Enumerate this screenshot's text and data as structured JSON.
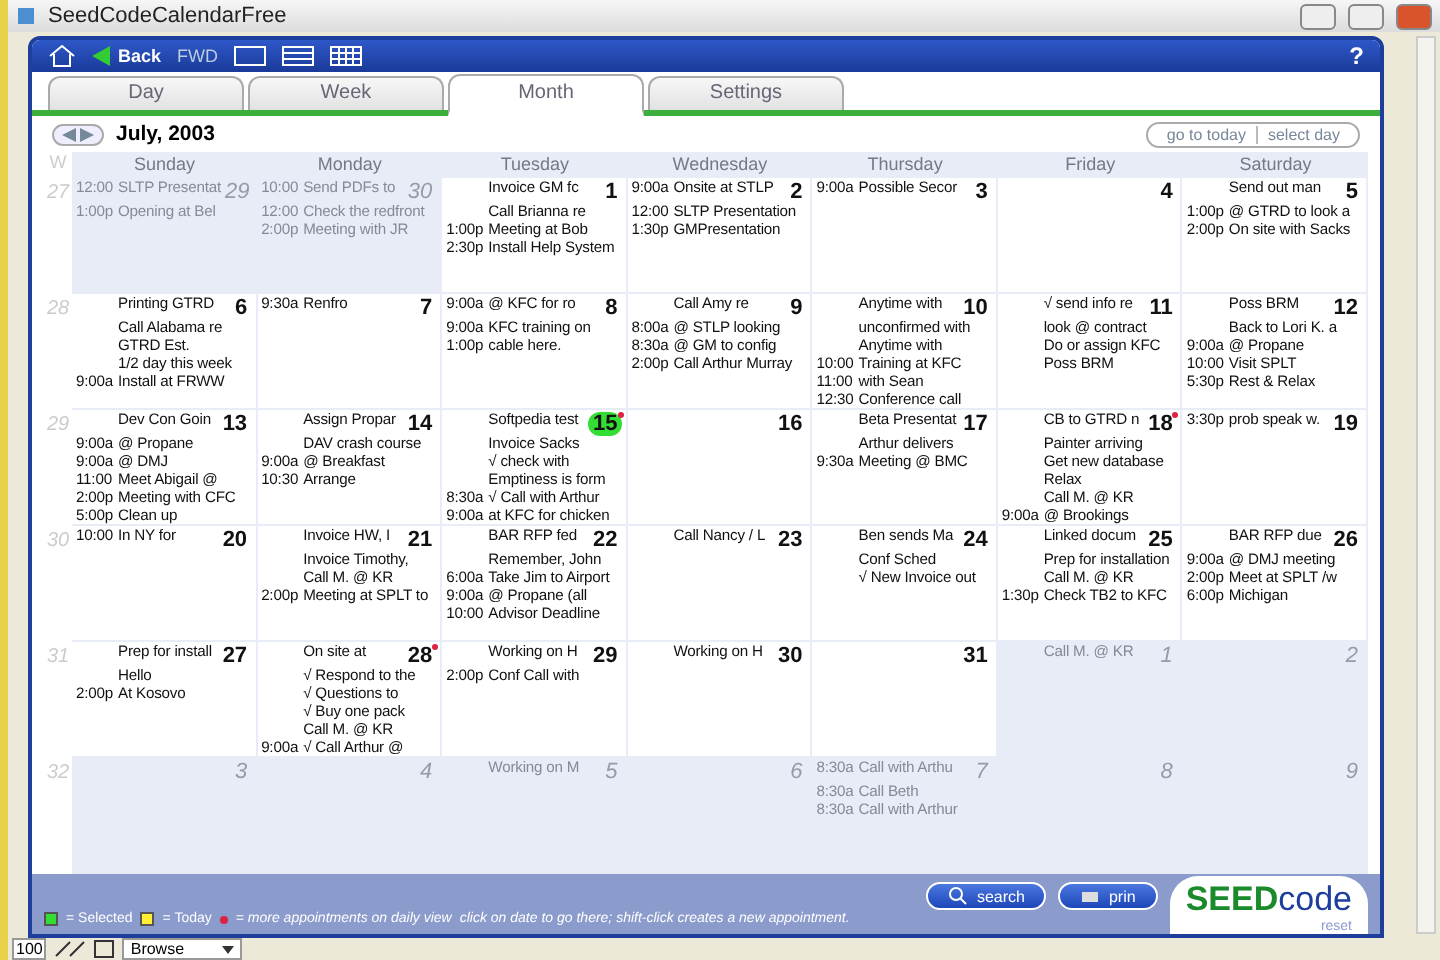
{
  "window": {
    "title": "SeedCodeCalendarFree"
  },
  "toolbar": {
    "back": "Back",
    "forward": "FWD",
    "help": "?"
  },
  "tabs": [
    {
      "label": "Day",
      "selected": false
    },
    {
      "label": "Week",
      "selected": false
    },
    {
      "label": "Month",
      "selected": true
    },
    {
      "label": "Settings",
      "selected": false
    }
  ],
  "month_nav": {
    "title": "July, 2003",
    "buttons": [
      "go to today",
      "select day"
    ]
  },
  "calendar": {
    "week_header": "W",
    "weekdays": [
      "Sunday",
      "Monday",
      "Tuesday",
      "Wednesday",
      "Thursday",
      "Friday",
      "Saturday"
    ],
    "weeks": [
      {
        "number": "27",
        "days": [
          {
            "date": "29",
            "in_month": false,
            "selected": false,
            "more": false,
            "items": [
              {
                "time": "12:00",
                "text": "SLTP Presentat"
              },
              {
                "time": "1:00p",
                "text": "Opening at Bel"
              }
            ]
          },
          {
            "date": "30",
            "in_month": false,
            "selected": false,
            "more": false,
            "items": [
              {
                "time": "10:00",
                "text": "Send PDFs to"
              },
              {
                "time": "12:00",
                "text": "Check the redfront"
              },
              {
                "time": "2:00p",
                "text": "Meeting with JR"
              }
            ]
          },
          {
            "date": "1",
            "in_month": true,
            "selected": false,
            "more": false,
            "items": [
              {
                "text": "Invoice GM fc"
              },
              {
                "text": "Call Brianna re"
              },
              {
                "time": "1:00p",
                "text": "Meeting at Bob"
              },
              {
                "time": "2:30p",
                "text": "Install Help System"
              }
            ]
          },
          {
            "date": "2",
            "in_month": true,
            "selected": false,
            "more": false,
            "items": [
              {
                "time": "9:00a",
                "text": "Onsite at STLP"
              },
              {
                "time": "12:00",
                "text": "SLTP Presentation"
              },
              {
                "time": "1:30p",
                "text": "GMPresentation"
              }
            ]
          },
          {
            "date": "3",
            "in_month": true,
            "selected": false,
            "more": false,
            "items": [
              {
                "time": "9:00a",
                "text": "Possible Secor"
              }
            ]
          },
          {
            "date": "4",
            "in_month": true,
            "selected": false,
            "more": false
          },
          {
            "date": "5",
            "in_month": true,
            "selected": false,
            "more": false,
            "items": [
              {
                "text": "Send out man"
              },
              {
                "time": "1:00p",
                "text": "@ GTRD to look a"
              },
              {
                "time": "2:00p",
                "text": "On site with Sacks"
              }
            ]
          }
        ]
      },
      {
        "number": "28",
        "days": [
          {
            "date": "6",
            "in_month": true,
            "selected": false,
            "more": false,
            "items": [
              {
                "text": "Printing GTRD"
              },
              {
                "text": "Call Alabama re"
              },
              {
                "text": "GTRD Est."
              },
              {
                "text": "1/2 day this week"
              },
              {
                "time": "9:00a",
                "text": "Install at FRWW"
              }
            ]
          },
          {
            "date": "7",
            "in_month": true,
            "selected": false,
            "more": false,
            "items": [
              {
                "time": "9:30a",
                "text": "Renfro"
              }
            ]
          },
          {
            "date": "8",
            "in_month": true,
            "selected": false,
            "more": false,
            "items": [
              {
                "time": "9:00a",
                "text": "@ KFC for ro"
              },
              {
                "time": "9:00a",
                "text": "KFC training on"
              },
              {
                "time": "1:00p",
                "text": "cable here."
              }
            ]
          },
          {
            "date": "9",
            "in_month": true,
            "selected": false,
            "more": false,
            "items": [
              {
                "text": "Call Amy re"
              },
              {
                "time": "8:00a",
                "text": "@ STLP looking"
              },
              {
                "time": "8:30a",
                "text": "@ GM to config"
              },
              {
                "time": "2:00p",
                "text": "Call Arthur Murray"
              }
            ]
          },
          {
            "date": "10",
            "in_month": true,
            "selected": false,
            "more": false,
            "items": [
              {
                "text": "Anytime with"
              },
              {
                "text": "unconfirmed with"
              },
              {
                "text": "Anytime with"
              },
              {
                "time": "10:00",
                "text": "Training at KFC"
              },
              {
                "time": "11:00",
                "text": "with Sean"
              },
              {
                "time": "12:30",
                "text": "Conference call"
              }
            ]
          },
          {
            "date": "11",
            "in_month": true,
            "selected": false,
            "more": false,
            "items": [
              {
                "text": "√ send info re"
              },
              {
                "text": "look @ contract"
              },
              {
                "text": "Do or assign KFC"
              },
              {
                "text": "Poss BRM"
              }
            ]
          },
          {
            "date": "12",
            "in_month": true,
            "selected": false,
            "more": false,
            "items": [
              {
                "text": "Poss BRM"
              },
              {
                "text": "Back to Lori K. a"
              },
              {
                "time": "9:00a",
                "text": "@ Propane"
              },
              {
                "time": "10:00",
                "text": "Visit SPLT"
              },
              {
                "time": "5:30p",
                "text": "Rest & Relax"
              }
            ]
          }
        ]
      },
      {
        "number": "29",
        "days": [
          {
            "date": "13",
            "in_month": true,
            "selected": false,
            "more": false,
            "items": [
              {
                "text": "Dev Con Goin"
              },
              {
                "time": "9:00a",
                "text": "@ Propane"
              },
              {
                "time": "9:00a",
                "text": "@ DMJ"
              },
              {
                "time": "11:00",
                "text": "Meet Abigail @"
              },
              {
                "time": "2:00p",
                "text": "Meeting with CFC"
              },
              {
                "time": "5:00p",
                "text": "Clean up"
              }
            ]
          },
          {
            "date": "14",
            "in_month": true,
            "selected": false,
            "more": false,
            "items": [
              {
                "text": "Assign Propar"
              },
              {
                "text": "DAV crash course"
              },
              {
                "time": "9:00a",
                "text": "@ Breakfast"
              },
              {
                "time": "10:30",
                "text": "Arrange"
              }
            ]
          },
          {
            "date": "15",
            "in_month": true,
            "selected": true,
            "more": true,
            "items": [
              {
                "text": "Softpedia test"
              },
              {
                "text": "Invoice Sacks"
              },
              {
                "text": "√ check with"
              },
              {
                "text": "Emptiness is form"
              },
              {
                "time": "8:30a",
                "text": "√ Call with Arthur"
              },
              {
                "time": "9:00a",
                "text": "at KFC for chicken"
              }
            ]
          },
          {
            "date": "16",
            "in_month": true,
            "selected": false,
            "more": false
          },
          {
            "date": "17",
            "in_month": true,
            "selected": false,
            "more": false,
            "items": [
              {
                "text": "Beta Presentat"
              },
              {
                "text": "Arthur delivers"
              },
              {
                "time": "9:30a",
                "text": "Meeting @ BMC"
              }
            ]
          },
          {
            "date": "18",
            "in_month": true,
            "selected": false,
            "more": true,
            "items": [
              {
                "text": "CB to GTRD n"
              },
              {
                "text": "Painter arriving"
              },
              {
                "text": "Get new database"
              },
              {
                "text": "Relax"
              },
              {
                "text": "Call M. @ KR"
              },
              {
                "time": "9:00a",
                "text": "@ Brookings"
              }
            ]
          },
          {
            "date": "19",
            "in_month": true,
            "selected": false,
            "more": false,
            "items": [
              {
                "time": "3:30p",
                "text": "prob speak w."
              }
            ]
          }
        ]
      },
      {
        "number": "30",
        "days": [
          {
            "date": "20",
            "in_month": true,
            "selected": false,
            "more": false,
            "items": [
              {
                "time": "10:00",
                "text": "In NY for"
              }
            ]
          },
          {
            "date": "21",
            "in_month": true,
            "selected": false,
            "more": false,
            "items": [
              {
                "text": "Invoice HW, I"
              },
              {
                "text": "Invoice Timothy,"
              },
              {
                "text": "Call M. @ KR"
              },
              {
                "time": "2:00p",
                "text": "Meeting at SPLT to"
              }
            ]
          },
          {
            "date": "22",
            "in_month": true,
            "selected": false,
            "more": false,
            "items": [
              {
                "text": "BAR RFP fed"
              },
              {
                "text": "Remember, John"
              },
              {
                "time": "6:00a",
                "text": "Take Jim to Airport"
              },
              {
                "time": "9:00a",
                "text": "@ Propane (all"
              },
              {
                "time": "10:00",
                "text": "Advisor Deadline"
              }
            ]
          },
          {
            "date": "23",
            "in_month": true,
            "selected": false,
            "more": false,
            "items": [
              {
                "text": "Call Nancy / L"
              }
            ]
          },
          {
            "date": "24",
            "in_month": true,
            "selected": false,
            "more": false,
            "items": [
              {
                "text": "Ben sends Ma"
              },
              {
                "text": "Conf Sched"
              },
              {
                "text": "√ New Invoice out"
              }
            ]
          },
          {
            "date": "25",
            "in_month": true,
            "selected": false,
            "more": false,
            "items": [
              {
                "text": "Linked docum"
              },
              {
                "text": "Prep for installation"
              },
              {
                "text": "Call M. @ KR"
              },
              {
                "time": "1:30p",
                "text": "Check TB2 to KFC"
              }
            ]
          },
          {
            "date": "26",
            "in_month": true,
            "selected": false,
            "more": false,
            "items": [
              {
                "text": "BAR RFP due"
              },
              {
                "time": "9:00a",
                "text": "@ DMJ meeting"
              },
              {
                "time": "2:00p",
                "text": "Meet at SPLT /w"
              },
              {
                "time": "6:00p",
                "text": "Michigan"
              }
            ]
          }
        ]
      },
      {
        "number": "31",
        "days": [
          {
            "date": "27",
            "in_month": true,
            "selected": false,
            "more": false,
            "items": [
              {
                "text": "Prep for install"
              },
              {
                "text": "Hello"
              },
              {
                "time": "2:00p",
                "text": "At Kosovo"
              }
            ]
          },
          {
            "date": "28",
            "in_month": true,
            "selected": false,
            "more": true,
            "items": [
              {
                "text": "On site at"
              },
              {
                "text": "√ Respond to the"
              },
              {
                "text": "√ Questions to"
              },
              {
                "text": "√ Buy one pack"
              },
              {
                "text": "Call M. @ KR"
              },
              {
                "time": "9:00a",
                "text": "√ Call Arthur @"
              }
            ]
          },
          {
            "date": "29",
            "in_month": true,
            "selected": false,
            "more": false,
            "items": [
              {
                "text": "Working on H"
              },
              {
                "time": "2:00p",
                "text": "Conf Call with"
              }
            ]
          },
          {
            "date": "30",
            "in_month": true,
            "selected": false,
            "more": false,
            "items": [
              {
                "text": "Working on H"
              }
            ]
          },
          {
            "date": "31",
            "in_month": true,
            "selected": false,
            "more": false
          },
          {
            "date": "1",
            "in_month": false,
            "selected": false,
            "more": false,
            "items": [
              {
                "text": "Call M. @ KR"
              }
            ]
          },
          {
            "date": "2",
            "in_month": false,
            "selected": false,
            "more": false
          }
        ]
      },
      {
        "number": "32",
        "days": [
          {
            "date": "3",
            "in_month": false,
            "selected": false,
            "more": false
          },
          {
            "date": "4",
            "in_month": false,
            "selected": false,
            "more": false
          },
          {
            "date": "5",
            "in_month": false,
            "selected": false,
            "more": false,
            "items": [
              {
                "text": "Working on M"
              }
            ]
          },
          {
            "date": "6",
            "in_month": false,
            "selected": false,
            "more": false
          },
          {
            "date": "7",
            "in_month": false,
            "selected": false,
            "more": false,
            "items": [
              {
                "time": "8:30a",
                "text": "Call with Arthu"
              },
              {
                "time": "8:30a",
                "text": "Call Beth"
              },
              {
                "time": "8:30a",
                "text": "Call with Arthur"
              }
            ]
          },
          {
            "date": "8",
            "in_month": false,
            "selected": false,
            "more": false
          },
          {
            "date": "9",
            "in_month": false,
            "selected": false,
            "more": false
          }
        ]
      }
    ]
  },
  "legend": {
    "selected": "= Selected",
    "today": "= Today",
    "more": "= more appointments on daily view",
    "hint": "click on date to go there; shift-click creates a new appointment."
  },
  "actions": [
    "search",
    "prin"
  ],
  "logo": {
    "bold": "SEED",
    "light": "code"
  },
  "reset": "reset",
  "status_bar": {
    "zoom": "100",
    "mode": "Browse"
  }
}
